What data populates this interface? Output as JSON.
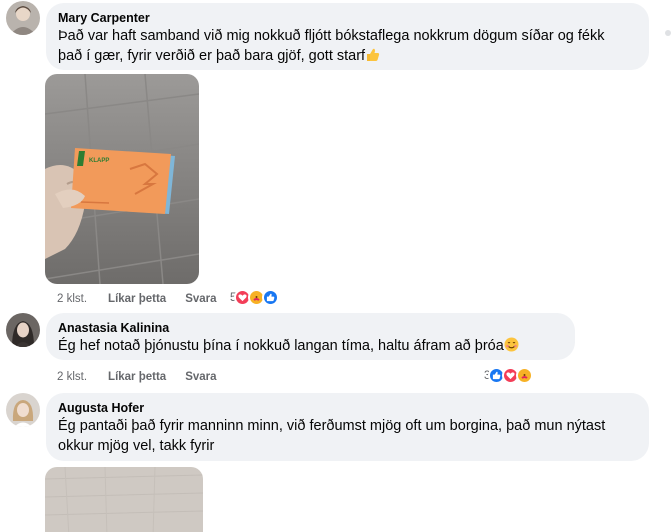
{
  "comments": [
    {
      "author": "Mary Carpenter",
      "lines": [
        "Það var haft samband við mig nokkuð fljótt bókstaflega nokkrum dögum síðar og fékk",
        "það í gær, fyrir verðið er það bara gjöf, gott starf"
      ],
      "trailing_emoji": "thumbs-up",
      "has_photo": true,
      "card_brand": "KLAPP",
      "time": "2 klst.",
      "like_label": "Líkar þetta",
      "reply_label": "Svara",
      "reaction_count": "5",
      "reactions": [
        "love",
        "care",
        "like"
      ]
    },
    {
      "author": "Anastasia Kalinina",
      "lines": [
        "Ég hef notað þjónustu þína í nokkuð langan tíma, haltu áfram að þróa"
      ],
      "trailing_emoji": "smiling-face",
      "time": "2 klst.",
      "like_label": "Líkar þetta",
      "reply_label": "Svara",
      "reaction_count": "3",
      "reactions": [
        "like",
        "love",
        "care"
      ]
    },
    {
      "author": "Augusta Hofer",
      "lines": [
        "Ég pantaði það fyrir manninn minn, við ferðumst mjög oft um borgina, það mun nýtast",
        "okkur mjög vel, takk fyrir"
      ],
      "has_photo": true
    }
  ],
  "colors": {
    "bubble": "#f0f2f5",
    "meta_text": "#65676b",
    "like": "#1877f2",
    "love": "#f33e58",
    "care": "#f7b125",
    "card": "#f29a5a"
  }
}
